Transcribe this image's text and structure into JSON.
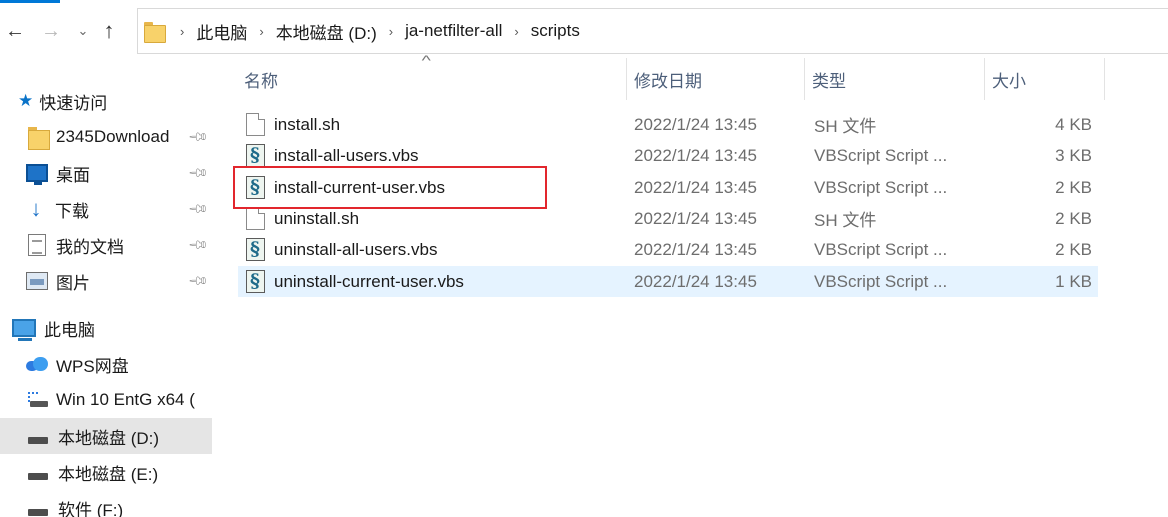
{
  "address_bar": {
    "breadcrumbs": [
      "此电脑",
      "本地磁盘 (D:)",
      "ja-netfilter-all",
      "scripts"
    ]
  },
  "sidebar": {
    "quick_access_label": "快速访问",
    "quick_items": [
      {
        "label": "2345Download",
        "icon": "folder-icon",
        "pinned": true
      },
      {
        "label": "桌面",
        "icon": "desktop-icon",
        "pinned": true
      },
      {
        "label": "下载",
        "icon": "download-icon",
        "pinned": true
      },
      {
        "label": "我的文档",
        "icon": "documents-icon",
        "pinned": true
      },
      {
        "label": "图片",
        "icon": "pictures-icon",
        "pinned": true
      }
    ],
    "this_pc_label": "此电脑",
    "pc_items": [
      {
        "label": "WPS网盘",
        "icon": "cloud-icon"
      },
      {
        "label": "Win 10 EntG x64 (",
        "icon": "usb-drive-icon"
      },
      {
        "label": "本地磁盘 (D:)",
        "icon": "drive-icon",
        "selected": true
      },
      {
        "label": "本地磁盘 (E:)",
        "icon": "drive-icon"
      },
      {
        "label": "软件 (F:)",
        "icon": "drive-icon"
      }
    ]
  },
  "columns": {
    "name": "名称",
    "date": "修改日期",
    "type": "类型",
    "size": "大小"
  },
  "files": [
    {
      "name": "install.sh",
      "date": "2022/1/24 13:45",
      "type": "SH 文件",
      "size": "4 KB",
      "icon": "sh"
    },
    {
      "name": "install-all-users.vbs",
      "date": "2022/1/24 13:45",
      "type": "VBScript Script ...",
      "size": "3 KB",
      "icon": "vbs"
    },
    {
      "name": "install-current-user.vbs",
      "date": "2022/1/24 13:45",
      "type": "VBScript Script ...",
      "size": "2 KB",
      "icon": "vbs",
      "highlighted": true
    },
    {
      "name": "uninstall.sh",
      "date": "2022/1/24 13:45",
      "type": "SH 文件",
      "size": "2 KB",
      "icon": "sh"
    },
    {
      "name": "uninstall-all-users.vbs",
      "date": "2022/1/24 13:45",
      "type": "VBScript Script ...",
      "size": "2 KB",
      "icon": "vbs"
    },
    {
      "name": "uninstall-current-user.vbs",
      "date": "2022/1/24 13:45",
      "type": "VBScript Script ...",
      "size": "1 KB",
      "icon": "vbs",
      "selected": true
    }
  ],
  "colors": {
    "accent": "#0078d7",
    "selection": "#e5f3ff",
    "annotation": "#e2262d"
  }
}
